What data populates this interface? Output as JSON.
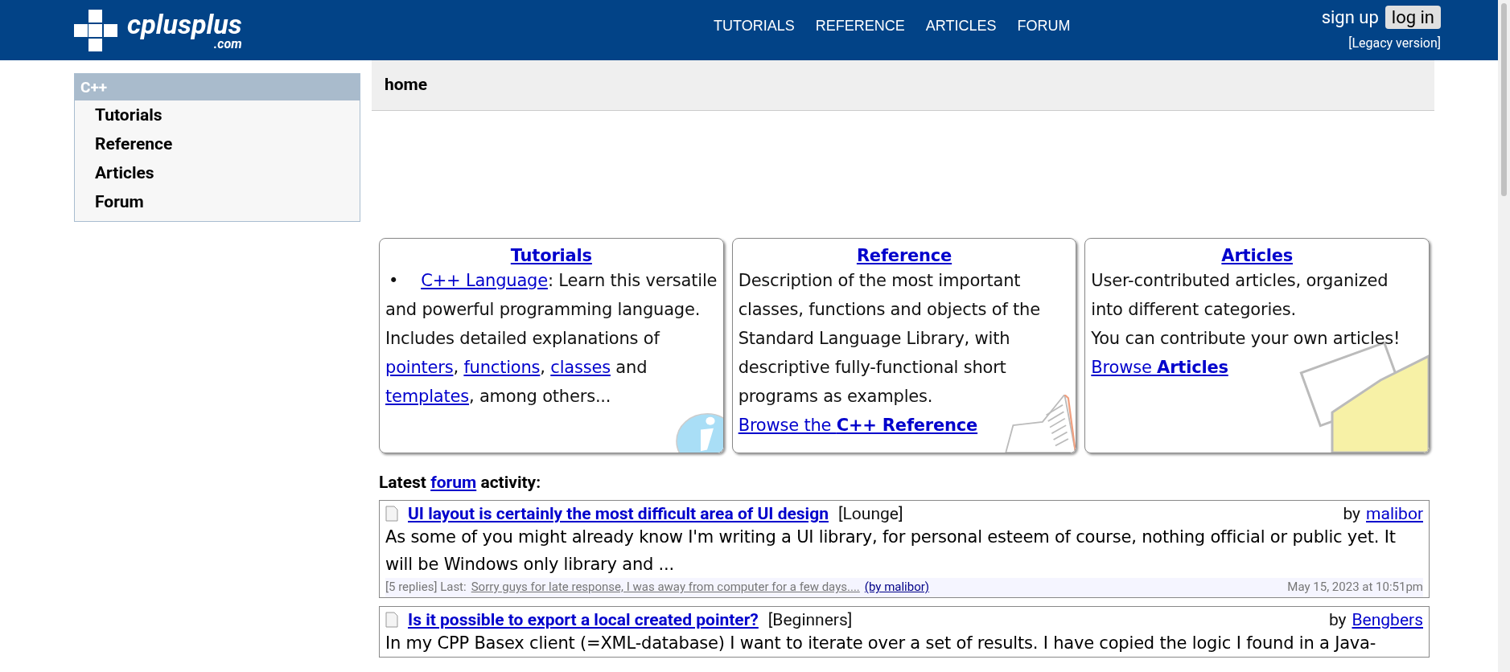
{
  "header": {
    "logo_text": "cplusplus",
    "logo_sub": ".com",
    "nav": [
      "TUTORIALS",
      "REFERENCE",
      "ARTICLES",
      "FORUM"
    ],
    "sign_up": "sign up",
    "log_in": "log in",
    "legacy": "[Legacy version]"
  },
  "sidebar": {
    "title": "C++",
    "items": [
      {
        "label": "Tutorials"
      },
      {
        "label": "Reference"
      },
      {
        "label": "Articles"
      },
      {
        "label": "Forum"
      }
    ]
  },
  "breadcrumb": "home",
  "cards": [
    {
      "kind": "info",
      "title": "Tutorials",
      "bullet": "•",
      "segments": [
        {
          "kind": "link",
          "text": "C++ Language"
        },
        {
          "kind": "text",
          "text": ": Learn this versatile and powerful programming language. Includes detailed explanations of "
        },
        {
          "kind": "link",
          "text": "pointers"
        },
        {
          "kind": "text",
          "text": ", "
        },
        {
          "kind": "link",
          "text": "functions"
        },
        {
          "kind": "text",
          "text": ", "
        },
        {
          "kind": "link",
          "text": "classes"
        },
        {
          "kind": "text",
          "text": " and "
        },
        {
          "kind": "link",
          "text": "templates"
        },
        {
          "kind": "text",
          "text": ", among others..."
        }
      ]
    },
    {
      "kind": "book",
      "title": "Reference",
      "text": "Description of the most important classes, functions and objects of the Standard Language Library, with descriptive fully-functional short programs as examples.",
      "browse": "Browse the **C++ Reference**"
    },
    {
      "kind": "folder",
      "title": "Articles",
      "text": "User-contributed articles, organized into different categories.",
      "text2": "You can contribute your own articles!",
      "browse": "Browse **Articles**"
    }
  ],
  "forum": {
    "label_before": "Latest",
    "link": "forum",
    "label_after": "activity:",
    "posts": [
      {
        "title": "UI layout is certainly the most difficult area of UI design",
        "category": "[Lounge]",
        "by": "by",
        "author": "malibor",
        "body": "As some of you might already know I'm writing a UI library, for personal esteem of course, nothing official or public yet. It will be Windows only library and ...",
        "replies": "[5 replies] Last:",
        "last": "Sorry guys for late response, I was away from computer for a few days....",
        "last_by": "(by malibor)",
        "date": "May 15, 2023 at 10:51pm"
      },
      {
        "title": "Is it possible to export a local created pointer?",
        "category": "[Beginners]",
        "by": "by",
        "author": "Bengbers",
        "body": "In my CPP Basex client (=XML-database) I want to iterate over a set of results. I have copied the logic I found in a Java-"
      }
    ]
  }
}
